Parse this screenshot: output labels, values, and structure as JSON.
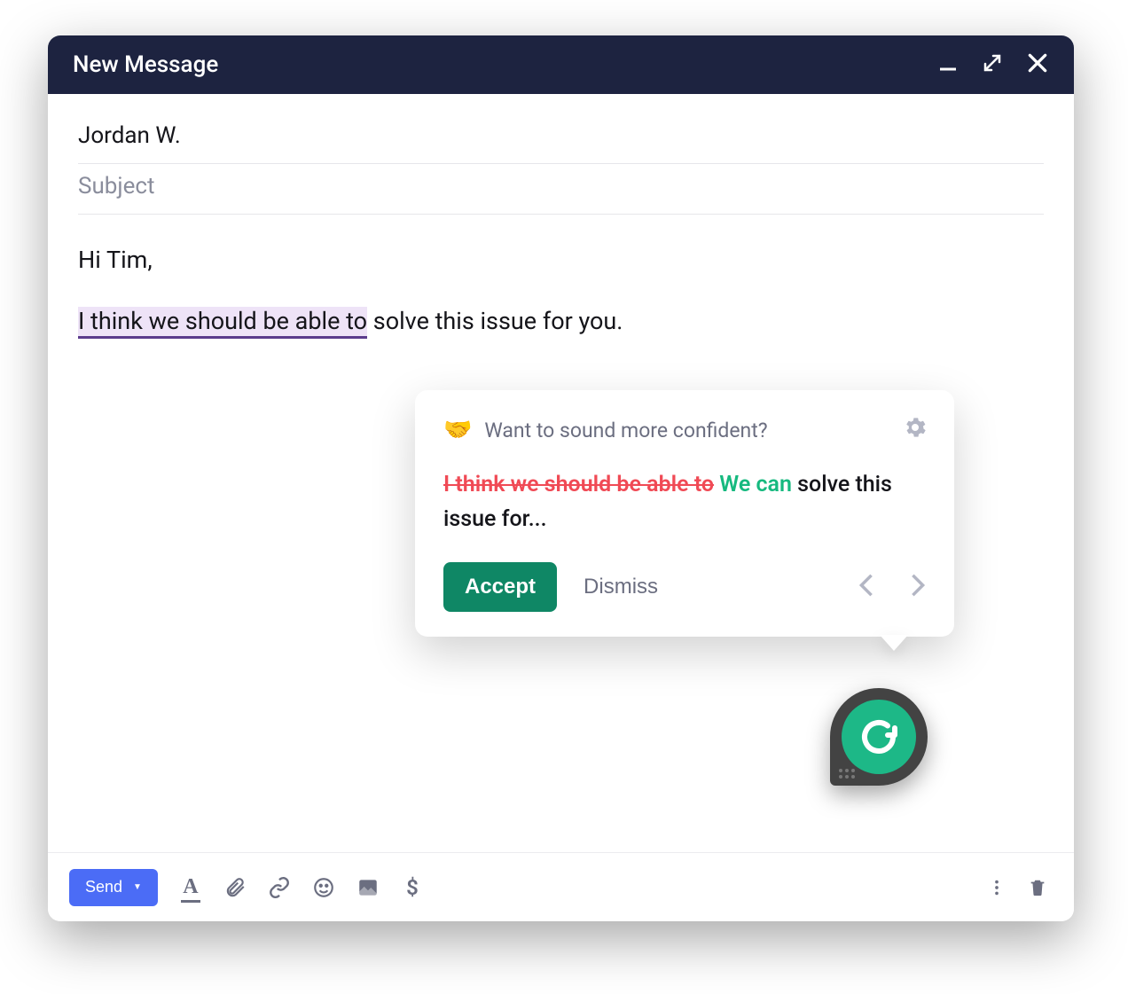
{
  "header": {
    "title": "New Message"
  },
  "fields": {
    "to_value": "Jordan W.",
    "subject_placeholder": "Subject"
  },
  "body": {
    "greeting": "Hi Tim,",
    "highlighted": "I think we should be able to",
    "line2_rest": " solve this issue for you."
  },
  "suggestion": {
    "emoji": "🤝",
    "title": "Want to sound more confident?",
    "strike_text": "I think we should be able to",
    "replacement": "We can",
    "rest": " solve this issue for...",
    "accept_label": "Accept",
    "dismiss_label": "Dismiss"
  },
  "toolbar": {
    "send_label": "Send",
    "dollar": "$"
  },
  "colors": {
    "header_bg": "#1d2340",
    "accent_blue": "#4b6cf6",
    "success_green": "#0f8765",
    "grammarly_green": "#1db887",
    "strike_red": "#f04a55",
    "highlight_bg": "#eee3f7",
    "highlight_underline": "#5b3b8c"
  }
}
